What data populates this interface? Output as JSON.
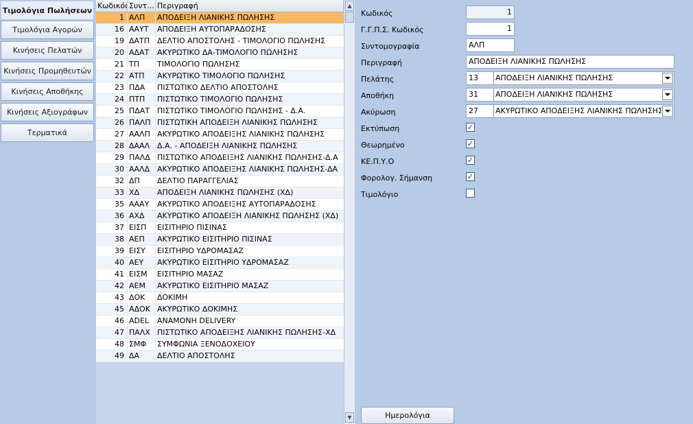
{
  "sidebar": {
    "items": [
      {
        "label": "Τιμολόγια Πωλήσεων",
        "active": true
      },
      {
        "label": "Τιμολόγια Αγορών"
      },
      {
        "label": "Κινήσεις Πελατών"
      },
      {
        "label": "Κινήσεις Προμηθευτών"
      },
      {
        "label": "Κινήσεις Αποθήκης"
      },
      {
        "label": "Κινήσεις Αξιογράφων"
      },
      {
        "label": "Τερματικά"
      }
    ]
  },
  "grid": {
    "columns": [
      "Κωδικός",
      "Συντ...",
      "Περιγραφή"
    ],
    "selected_index": 0,
    "rows": [
      {
        "code": "1",
        "abbr": "ΑΛΠ",
        "desc": "ΑΠΟΔΕΙΞΗ ΛΙΑΝΙΚΗΣ ΠΩΛΗΣΗΣ"
      },
      {
        "code": "16",
        "abbr": "ΑΑΥΤ",
        "desc": "ΑΠΟΔΕΙΞΗ ΑΥΤΟΠΑΡΑΔΟΣΗΣ"
      },
      {
        "code": "19",
        "abbr": "ΔΑΤΠ",
        "desc": "ΔΕΛΤΙΟ ΑΠΟΣΤΟΛΗΣ - ΤΙΜΟΛΟΓΙΟ ΠΩΛΗΣΗΣ"
      },
      {
        "code": "20",
        "abbr": "ΑΔΑΤ",
        "desc": "ΑΚΥΡΩΤΙΚΟ ΔΑ-ΤΙΜΟΛΟΓΙΟ ΠΩΛΗΣΗΣ"
      },
      {
        "code": "21",
        "abbr": "ΤΠ",
        "desc": "ΤΙΜΟΛΟΓΙΟ ΠΩΛΗΣΗΣ"
      },
      {
        "code": "22",
        "abbr": "ΑΤΠ",
        "desc": "ΑΚΥΡΩΤΙΚΟ ΤΙΜΟΛΟΓΙΟ ΠΩΛΗΣΗΣ"
      },
      {
        "code": "23",
        "abbr": "ΠΔΑ",
        "desc": "ΠΙΣΤΩΤΙΚΟ ΔΕΛΤΙΟ ΑΠΟΣΤΟΛΗΣ"
      },
      {
        "code": "24",
        "abbr": "ΠΤΠ",
        "desc": "ΠΙΣΤΩΤΙΚΟ ΤΙΜΟΛΟΓΙΟ ΠΩΛΗΣΗΣ"
      },
      {
        "code": "25",
        "abbr": "ΠΔΑΤ",
        "desc": "ΠΙΣΤΩΤΙΚΟ ΤΙΜΟΛΟΓΙΟ ΠΩΛΗΣΗΣ - Δ.Α."
      },
      {
        "code": "26",
        "abbr": "ΠΑΛΠ",
        "desc": "ΠΙΣΤΩΤΙΚΗ ΑΠΟΔΕΙΞΗ ΛΙΑΝΙΚΗΣ ΠΩΛΗΣΗΣ"
      },
      {
        "code": "27",
        "abbr": "ΑΑΛΠ",
        "desc": "ΑΚΥΡΩΤΙΚΟ ΑΠΟΔΕΙΞΗΣ ΛΙΑΝΙΚΗΣ ΠΩΛΗΣΗΣ"
      },
      {
        "code": "28",
        "abbr": "ΔΑΑΛ",
        "desc": "Δ.Α. - ΑΠΟΔΕΙΞΗ ΛΙΑΝΙΚΗΣ ΠΩΛΗΣΗΣ"
      },
      {
        "code": "29",
        "abbr": "ΠΑΛΔ",
        "desc": "ΠΙΣΤΩΤΙΚΟ ΑΠΟΔΕΙΞΗΣ ΛΙΑΝΙΚΗΣ ΠΩΛΗΣΗΣ-Δ.Α"
      },
      {
        "code": "30",
        "abbr": "ΑΑΛΔ",
        "desc": "ΑΚΥΡΩΤΙΚΟ ΑΠΟΔΕΙΞΗΣ ΛΙΑΝΙΚΗΣ ΠΩΛΗΣΗΣ-ΔΑ"
      },
      {
        "code": "32",
        "abbr": "ΔΠ",
        "desc": "ΔΕΛΤΙΟ ΠΑΡΑΓΓΕΛΙΑΣ"
      },
      {
        "code": "33",
        "abbr": "ΧΔ",
        "desc": "ΑΠΟΔΕΙΞΗ ΛΙΑΝΙΚΗΣ ΠΩΛΗΣΗΣ (ΧΔ)"
      },
      {
        "code": "35",
        "abbr": "ΑΑΑΥ",
        "desc": "ΑΚΥΡΩΤΙΚΟ ΑΠΟΔΕΙΞΗΣ ΑΥΤΟΠΑΡΑΔΟΣΗΣ"
      },
      {
        "code": "36",
        "abbr": "ΑΧΔ",
        "desc": "ΑΚΥΡΩΤΙΚΟ ΑΠΟΔΕΙΞΗ ΛΙΑΝΙΚΗΣ ΠΩΛΗΣΗΣ (ΧΔ)"
      },
      {
        "code": "37",
        "abbr": "ΕΙΣΠ",
        "desc": "ΕΙΣΙΤΗΡΙΟ ΠΙΣΙΝΑΣ"
      },
      {
        "code": "38",
        "abbr": "ΑΕΠ",
        "desc": "ΑΚΥΡΩΤΙΚΟ ΕΙΣΙΤΗΡΙΟ ΠΙΣΙΝΑΣ"
      },
      {
        "code": "39",
        "abbr": "ΕΙΣΥ",
        "desc": "ΕΙΣΙΤΗΡΙΟ ΥΔΡΟΜΑΣΑΖ"
      },
      {
        "code": "40",
        "abbr": "ΑΕΥ",
        "desc": "ΑΚΥΡΩΤΙΚΟ ΕΙΣΙΤΗΡΙΟ ΥΔΡΟΜΑΣΑΖ"
      },
      {
        "code": "41",
        "abbr": "ΕΙΣΜ",
        "desc": "ΕΙΣΙΤΗΡΙΟ ΜΑΣΑΖ"
      },
      {
        "code": "42",
        "abbr": "ΑΕΜ",
        "desc": "ΑΚΥΡΩΤΙΚΟ ΕΙΣΙΤΗΡΙΟ ΜΑΣΑΖ"
      },
      {
        "code": "43",
        "abbr": "ΔΟΚ",
        "desc": "ΔΟΚΙΜΗ"
      },
      {
        "code": "45",
        "abbr": "ΑΔΟΚ",
        "desc": "ΑΚΥΡΩΤΙΚΟ ΔΟΚΙΜΗΣ"
      },
      {
        "code": "46",
        "abbr": "ADEL",
        "desc": "ΑΝΑΜΟΝΗ DELIVERY"
      },
      {
        "code": "47",
        "abbr": "ΠΑΛΧ",
        "desc": "ΠΙΣΤΩΤΙΚΟ ΑΠΟΔΕΙΞΗΣ ΛΙΑΝΙΚΗΣ ΠΩΛΗΣΗΣ-ΧΔ"
      },
      {
        "code": "48",
        "abbr": "ΣΜΦ",
        "desc": "ΣΥΜΦΩΝΙΑ ΞΕΝΟΔΟΧΕΙΟΥ"
      },
      {
        "code": "49",
        "abbr": "ΔΑ",
        "desc": "ΔΕΛΤΙΟ ΑΠΟΣΤΟΛΗΣ"
      }
    ]
  },
  "detail": {
    "code": {
      "label": "Κωδικός",
      "value": "1"
    },
    "ggps_code": {
      "label": "Γ.Γ.Π.Σ. Κωδικός",
      "value": "1"
    },
    "abbreviation": {
      "label": "Συντομογραφία",
      "value": "ΑΛΠ"
    },
    "description": {
      "label": "Περιγραφή",
      "value": "ΑΠΟΔΕΙΞΗ ΛΙΑΝΙΚΗΣ ΠΩΛΗΣΗΣ"
    },
    "customer": {
      "label": "Πελάτης",
      "code": "13",
      "value": "ΑΠΟΔΕΙΞΗ ΛΙΑΝΙΚΗΣ ΠΩΛΗΣΗΣ"
    },
    "warehouse": {
      "label": "Αποθήκη",
      "code": "31",
      "value": "ΑΠΟΔΕΙΞΗ ΛΙΑΝΙΚΗΣ ΠΩΛΗΣΗΣ"
    },
    "cancellation": {
      "label": "Ακύρωση",
      "code": "27",
      "value": "ΑΚΥΡΩΤΙΚΟ ΑΠΟΔΕΙΞΗΣ ΛΙΑΝΙΚΗΣ ΠΩΛΗΣΗΣ"
    },
    "checks": [
      {
        "label": "Εκτύπωση",
        "checked": true
      },
      {
        "label": "Θεωρημένο",
        "checked": true
      },
      {
        "label": "ΚΕ.Π.Υ.Ο",
        "checked": true
      },
      {
        "label": "Φορολογ. Σήμανση",
        "checked": true
      },
      {
        "label": "Τιμολόγιο",
        "checked": false
      }
    ],
    "calendar_button": "Ημερολόγια"
  },
  "icons": {
    "scroll_up": "scroll-up-arrow-icon",
    "scroll_down": "scroll-down-arrow-icon",
    "dropdown": "dropdown-arrow-icon",
    "check": "checkmark-icon"
  },
  "colors": {
    "background": "#b7cae6",
    "selected_row": "#f8b862",
    "alt_row": "#eff4fb"
  }
}
